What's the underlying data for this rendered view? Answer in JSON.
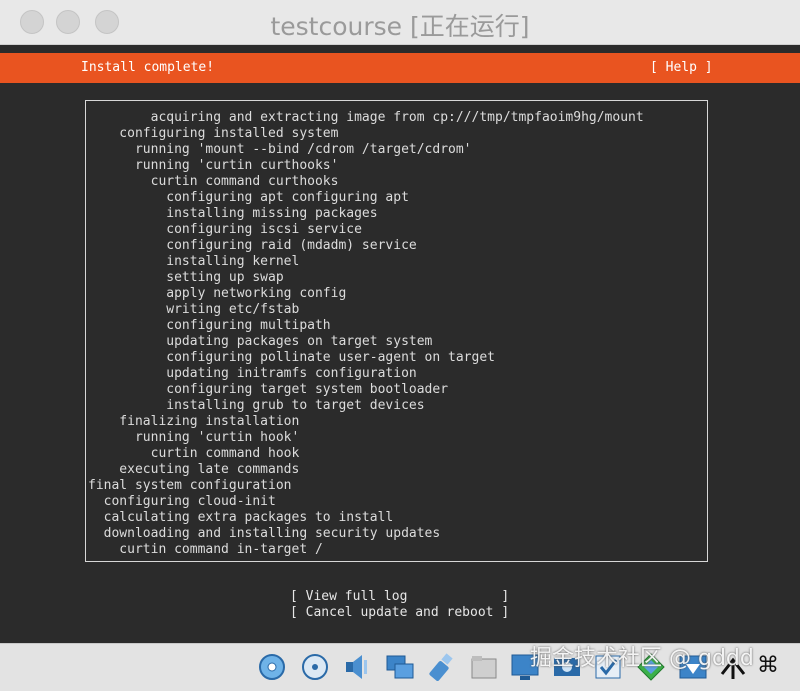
{
  "window": {
    "title": "testcourse [正在运行]"
  },
  "header": {
    "status": "Install complete!",
    "help": "[ Help ]"
  },
  "log_lines": [
    "        acquiring and extracting image from cp:///tmp/tmpfaoim9hg/mount",
    "    configuring installed system",
    "      running 'mount --bind /cdrom /target/cdrom'",
    "      running 'curtin curthooks'",
    "        curtin command curthooks",
    "          configuring apt configuring apt",
    "          installing missing packages",
    "          configuring iscsi service",
    "          configuring raid (mdadm) service",
    "          installing kernel",
    "          setting up swap",
    "          apply networking config",
    "          writing etc/fstab",
    "          configuring multipath",
    "          updating packages on target system",
    "          configuring pollinate user-agent on target",
    "          updating initramfs configuration",
    "          configuring target system bootloader",
    "          installing grub to target devices",
    "    finalizing installation",
    "      running 'curtin hook'",
    "        curtin command hook",
    "    executing late commands",
    "final system configuration",
    "  configuring cloud-init",
    "  calculating extra packages to install",
    "  downloading and installing security updates",
    "    curtin command in-target /"
  ],
  "scroll": {
    "up_glyph": "▲",
    "down_glyph": "▼"
  },
  "actions": {
    "view_log": "[ View full log            ]",
    "cancel_reboot": "[ Cancel update and reboot ]"
  },
  "overlay": {
    "watermark": "掘金技术社区 @ gddd",
    "cmd_key": "⌘"
  },
  "colors": {
    "header_bg": "#e95420",
    "screen_bg": "#2b2b2b",
    "text": "#dcdcdc"
  },
  "status_icons": [
    "hard-disk-icon",
    "optical-disk-icon",
    "audio-icon",
    "network-icon",
    "usb-icon",
    "shared-folder-icon",
    "display-icon",
    "video-capture-icon",
    "guest-additions-icon",
    "down-arrow-icon",
    "mouse-integration-icon",
    "host-key-icon"
  ]
}
